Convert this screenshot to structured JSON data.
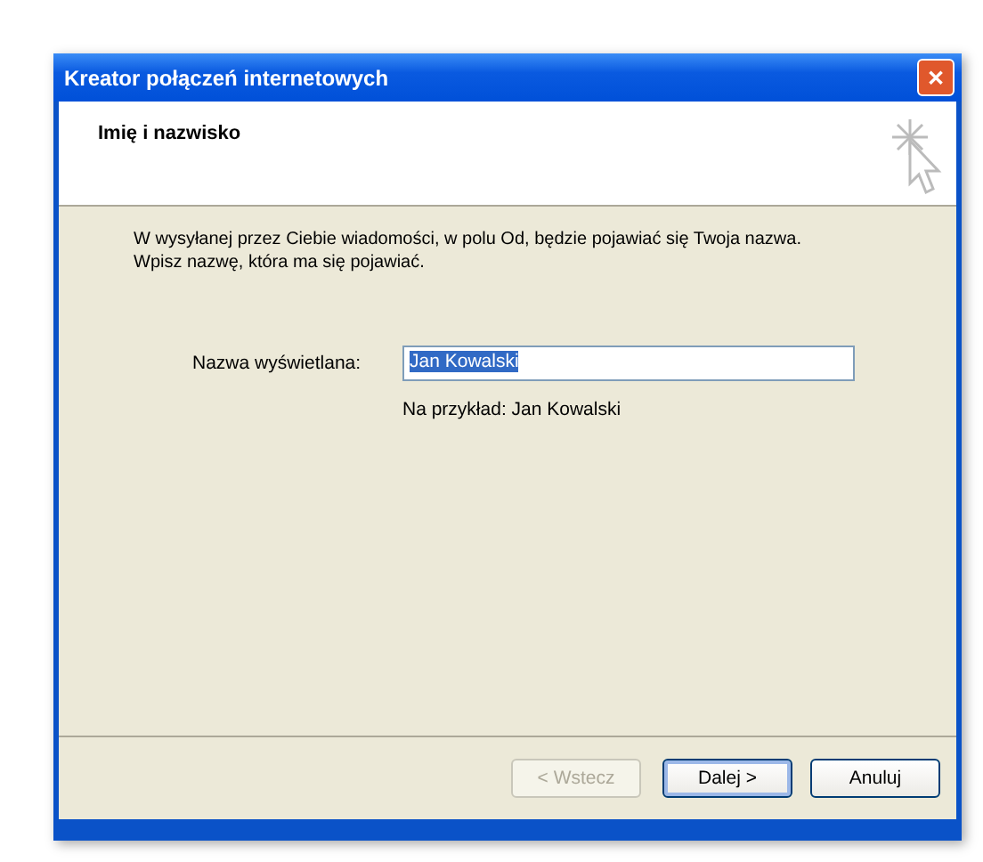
{
  "window": {
    "title": "Kreator połączeń internetowych",
    "close_glyph": "✕"
  },
  "header": {
    "title": "Imię i nazwisko"
  },
  "description": [
    "W wysyłanej przez Ciebie wiadomości, w polu Od, będzie pojawiać się Twoja nazwa.",
    "Wpisz nazwę, która ma się pojawiać."
  ],
  "field": {
    "label": "Nazwa wyświetlana:",
    "value": "Jan Kowalski",
    "value_selected": true,
    "hint": "Na przykład: Jan Kowalski"
  },
  "buttons": [
    {
      "label": "< Wstecz",
      "disabled": true,
      "default": false
    },
    {
      "label": "Dalej >",
      "disabled": false,
      "default": true
    },
    {
      "label": "Anuluj",
      "disabled": false,
      "default": false
    }
  ]
}
